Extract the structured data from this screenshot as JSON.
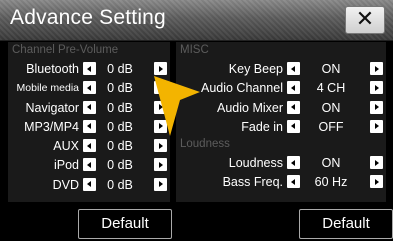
{
  "title": "Advance Setting",
  "close_label": "✕",
  "left": {
    "section": "Channel Pre-Volume",
    "rows": [
      {
        "label": "Bluetooth",
        "value": "0 dB"
      },
      {
        "label": "Mobile media",
        "value": "0 dB"
      },
      {
        "label": "Navigator",
        "value": "0 dB"
      },
      {
        "label": "MP3/MP4",
        "value": "0 dB"
      },
      {
        "label": "AUX",
        "value": "0 dB"
      },
      {
        "label": "iPod",
        "value": "0 dB"
      },
      {
        "label": "DVD",
        "value": "0 dB"
      }
    ],
    "default_label": "Default"
  },
  "right": {
    "misc_section": "MISC",
    "misc_rows": [
      {
        "label": "Key Beep",
        "value": "ON"
      },
      {
        "label": "Audio Channel",
        "value": "4 CH"
      },
      {
        "label": "Audio Mixer",
        "value": "ON"
      },
      {
        "label": "Fade in",
        "value": "OFF"
      }
    ],
    "loudness_section": "Loudness",
    "loudness_rows": [
      {
        "label": "Loudness",
        "value": "ON"
      },
      {
        "label": "Bass Freq.",
        "value": "60 Hz"
      }
    ],
    "default_label": "Default"
  },
  "colors": {
    "pointer": "#f3b400",
    "section_text": "#5c5c5c",
    "panel": "#1a1a1a"
  }
}
